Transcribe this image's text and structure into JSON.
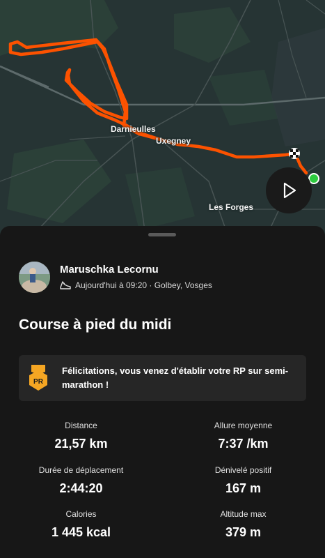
{
  "map": {
    "places": [
      "Darnieulles",
      "Uxegney",
      "Les Forges"
    ],
    "route_color": "#fc5200",
    "start_color": "#2ecc40"
  },
  "play_button": {
    "icon": "play-icon"
  },
  "activity": {
    "athlete_name": "Maruschka Lecornu",
    "sport_icon": "running-shoe-icon",
    "datetime_location": "Aujourd'hui à 09:20 · Golbey, Vosges",
    "title": "Course à pied du midi",
    "pr": {
      "badge_text": "PR",
      "message": "Félicitations, vous venez d'établir votre RP sur semi-marathon !",
      "badge_color": "#f5a623"
    },
    "stats": [
      {
        "label": "Distance",
        "value": "21,57 km"
      },
      {
        "label": "Allure moyenne",
        "value": "7:37 /km"
      },
      {
        "label": "Durée de déplacement",
        "value": "2:44:20"
      },
      {
        "label": "Dénivelé positif",
        "value": "167 m"
      },
      {
        "label": "Calories",
        "value": "1 445 kcal"
      },
      {
        "label": "Altitude max",
        "value": "379 m"
      }
    ]
  }
}
